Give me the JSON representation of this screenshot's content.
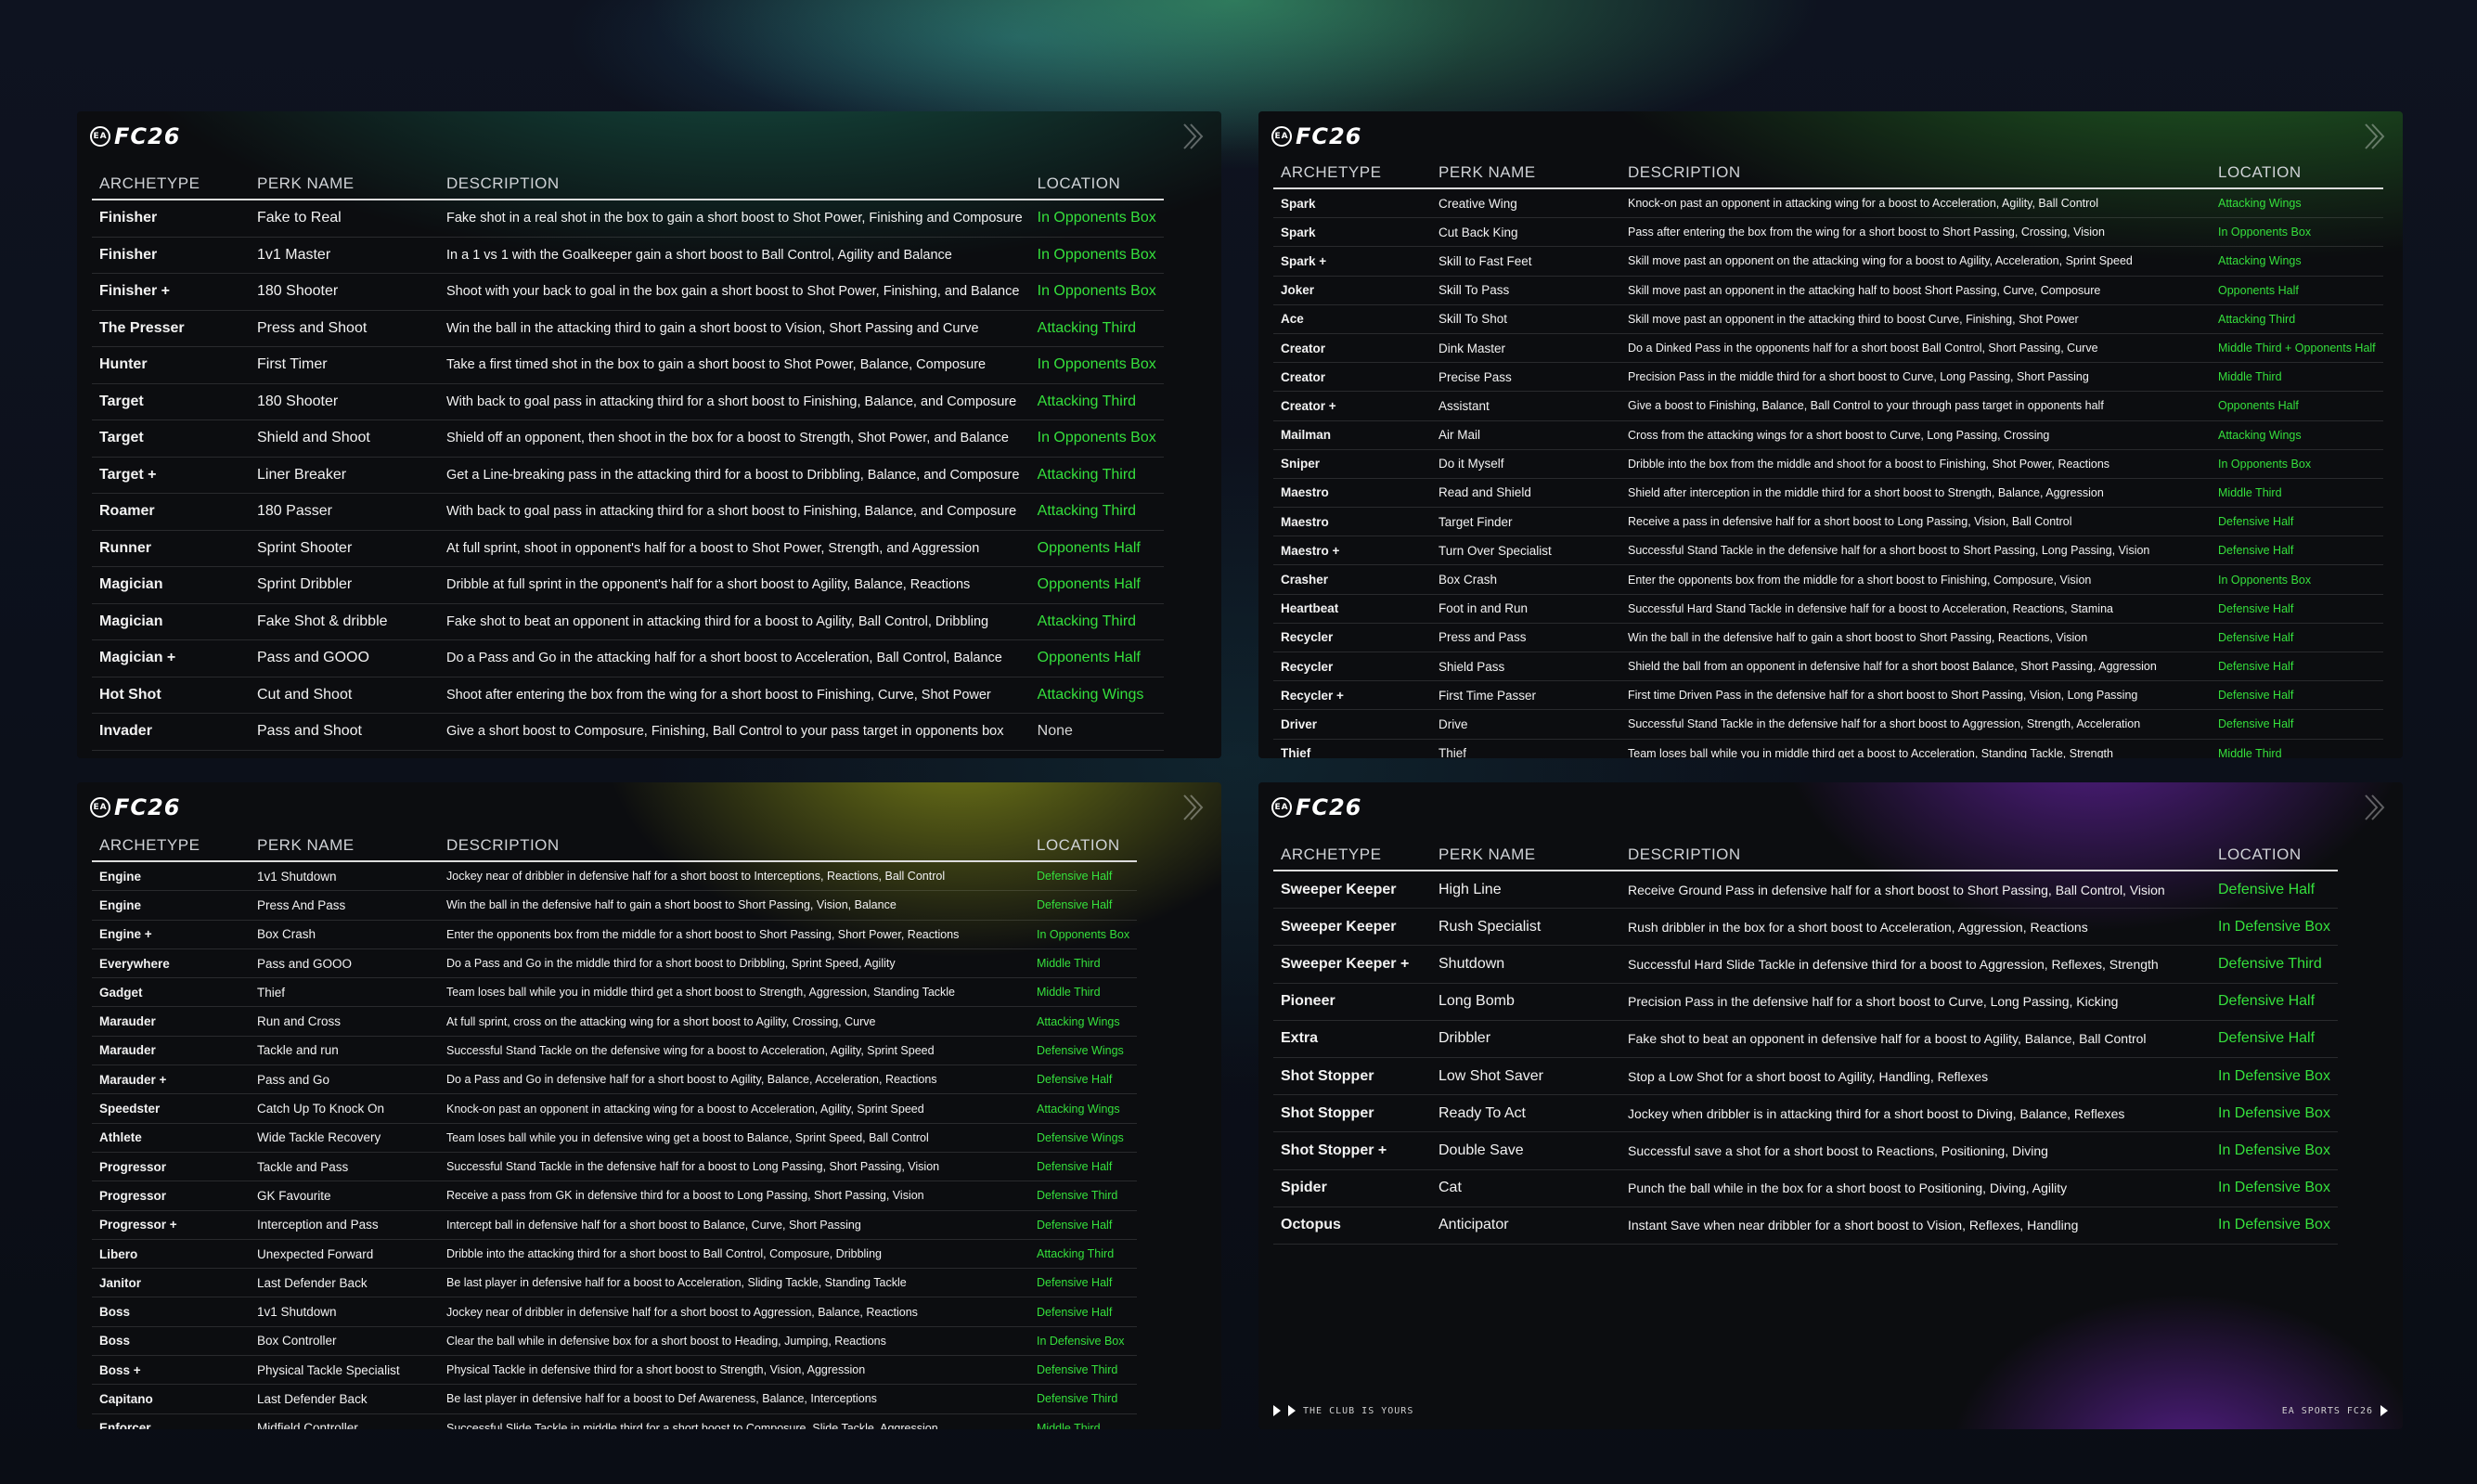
{
  "brand": {
    "logo_text": "FC26",
    "ea_badge": "EA"
  },
  "colors": {
    "location_green": "#35e03c",
    "accent_yellow": "#c8d41e",
    "accent_purple": "#8a2be2"
  },
  "headers": {
    "archetype": "ARCHETYPE",
    "perk_name": "PERK NAME",
    "description": "DESCRIPTION",
    "location": "LOCATION"
  },
  "panel_tl": {
    "rows": [
      {
        "archetype": "Finisher",
        "perk": "Fake to Real",
        "desc": "Fake shot in a real shot in the box to gain a short boost to Shot Power, Finishing and Composure",
        "loc": "In Opponents Box"
      },
      {
        "archetype": "Finisher",
        "perk": "1v1 Master",
        "desc": "In a 1 vs 1 with the Goalkeeper gain a short boost to Ball Control, Agility and Balance",
        "loc": "In Opponents Box"
      },
      {
        "archetype": "Finisher +",
        "perk": "180 Shooter",
        "desc": "Shoot with your back to goal in the box gain a short boost to Shot Power, Finishing, and Balance",
        "loc": "In Opponents Box"
      },
      {
        "archetype": "The Presser",
        "perk": "Press and Shoot",
        "desc": "Win the ball in the attacking third to gain a short boost to Vision, Short Passing and Curve",
        "loc": "Attacking Third"
      },
      {
        "archetype": "Hunter",
        "perk": "First Timer",
        "desc": "Take a first timed shot in the box to gain a short boost to Shot Power, Balance, Composure",
        "loc": "In Opponents Box"
      },
      {
        "archetype": "Target",
        "perk": "180 Shooter",
        "desc": "With back to goal pass in attacking third for a short boost to Finishing, Balance, and Composure",
        "loc": "Attacking Third"
      },
      {
        "archetype": "Target",
        "perk": "Shield and Shoot",
        "desc": "Shield off an opponent, then shoot in the box for a boost to Strength, Shot Power, and Balance",
        "loc": "In Opponents Box"
      },
      {
        "archetype": "Target +",
        "perk": "Liner Breaker",
        "desc": "Get a Line-breaking pass in the attacking third for a boost to Dribbling, Balance, and Composure",
        "loc": "Attacking Third"
      },
      {
        "archetype": "Roamer",
        "perk": "180 Passer",
        "desc": "With back to goal pass in attacking third for a short boost to Finishing, Balance, and Composure",
        "loc": "Attacking Third"
      },
      {
        "archetype": "Runner",
        "perk": "Sprint Shooter",
        "desc": "At full sprint, shoot in opponent's half for a boost to Shot Power, Strength, and Aggression",
        "loc": "Opponents Half"
      },
      {
        "archetype": "Magician",
        "perk": "Sprint Dribbler",
        "desc": "Dribble at full sprint in the opponent's half for a short boost to Agility, Balance, Reactions",
        "loc": "Opponents Half"
      },
      {
        "archetype": "Magician",
        "perk": "Fake Shot & dribble",
        "desc": "Fake shot to beat an opponent in attacking third for a boost to Agility, Ball Control, Dribbling",
        "loc": "Attacking Third"
      },
      {
        "archetype": "Magician +",
        "perk": "Pass and GOOO",
        "desc": "Do a Pass and Go in the attacking half for a short boost to Acceleration, Ball Control, Balance",
        "loc": "Opponents Half"
      },
      {
        "archetype": "Hot Shot",
        "perk": "Cut and Shoot",
        "desc": "Shoot after entering the box from the wing for a short boost to Finishing, Curve, Shot Power",
        "loc": "Attacking Wings"
      },
      {
        "archetype": "Invader",
        "perk": "Pass and Shoot",
        "desc": "Give a short boost to Composure, Finishing, Ball Control to your pass target in opponents box",
        "loc": "None"
      }
    ]
  },
  "panel_tr": {
    "rows": [
      {
        "archetype": "Spark",
        "perk": "Creative Wing",
        "desc": "Knock-on past an opponent in attacking wing for a boost to Acceleration, Agility, Ball Control",
        "loc": "Attacking Wings"
      },
      {
        "archetype": "Spark",
        "perk": "Cut Back King",
        "desc": "Pass after entering the box from the wing for a short boost to Short Passing, Crossing, Vision",
        "loc": "In Opponents Box"
      },
      {
        "archetype": "Spark +",
        "perk": "Skill to Fast Feet",
        "desc": "Skill move past an opponent on the attacking wing for a boost to Agility, Acceleration, Sprint Speed",
        "loc": "Attacking Wings"
      },
      {
        "archetype": "Joker",
        "perk": "Skill To Pass",
        "desc": "Skill move past an opponent in the attacking half to boost Short Passing, Curve, Composure",
        "loc": "Opponents Half"
      },
      {
        "archetype": "Ace",
        "perk": "Skill To Shot",
        "desc": "Skill move past an opponent in the attacking third to boost Curve, Finishing, Shot Power",
        "loc": "Attacking Third"
      },
      {
        "archetype": "Creator",
        "perk": "Dink Master",
        "desc": "Do a Dinked Pass in the opponents half for a short boost Ball Control, Short Passing, Curve",
        "loc": "Middle Third + Opponents Half"
      },
      {
        "archetype": "Creator",
        "perk": "Precise Pass",
        "desc": "Precision Pass in the middle third for a short boost to Curve, Long Passing, Short Passing",
        "loc": "Middle Third"
      },
      {
        "archetype": "Creator +",
        "perk": "Assistant",
        "desc": "Give a boost to Finishing, Balance, Ball Control to your through pass target in opponents half",
        "loc": "Opponents Half"
      },
      {
        "archetype": "Mailman",
        "perk": "Air Mail",
        "desc": "Cross from the attacking wings for a short boost to Curve, Long Passing, Crossing",
        "loc": "Attacking Wings"
      },
      {
        "archetype": "Sniper",
        "perk": "Do it Myself",
        "desc": "Dribble into the box from the middle and shoot for a boost to Finishing, Shot Power, Reactions",
        "loc": "In Opponents Box"
      },
      {
        "archetype": "Maestro",
        "perk": "Read and Shield",
        "desc": "Shield after interception in the middle third for a short boost to Strength, Balance, Aggression",
        "loc": "Middle Third"
      },
      {
        "archetype": "Maestro",
        "perk": "Target Finder",
        "desc": "Receive a pass in defensive half for a short boost to Long Passing, Vision, Ball Control",
        "loc": "Defensive Half"
      },
      {
        "archetype": "Maestro +",
        "perk": "Turn Over Specialist",
        "desc": "Successful Stand Tackle in the defensive half for a short boost to Short Passing, Long Passing, Vision",
        "loc": "Defensive Half"
      },
      {
        "archetype": "Crasher",
        "perk": "Box Crash",
        "desc": "Enter the opponents box from the middle for a short boost to Finishing, Composure, Vision",
        "loc": "In Opponents Box"
      },
      {
        "archetype": "Heartbeat",
        "perk": "Foot in and Run",
        "desc": "Successful Hard Stand Tackle in defensive half for a boost to Acceleration, Reactions, Stamina",
        "loc": "Defensive Half"
      },
      {
        "archetype": "Recycler",
        "perk": "Press and Pass",
        "desc": "Win the ball in the defensive half to gain a short boost to Short Passing, Reactions, Vision",
        "loc": "Defensive Half"
      },
      {
        "archetype": "Recycler",
        "perk": "Shield Pass",
        "desc": "Shield the ball from an opponent in defensive half for a short boost Balance, Short Passing, Aggression",
        "loc": "Defensive Half"
      },
      {
        "archetype": "Recycler +",
        "perk": "First Time Passer",
        "desc": "First time Driven Pass in the defensive half for a short boost to Short Passing, Vision, Long Passing",
        "loc": "Defensive Half"
      },
      {
        "archetype": "Driver",
        "perk": "Drive",
        "desc": "Successful Stand Tackle in the defensive half for a short boost to Aggression, Strength, Acceleration",
        "loc": "Defensive Half"
      },
      {
        "archetype": "Thief",
        "perk": "Thief",
        "desc": "Team loses ball while you in middle third get a boost to Acceleration, Standing Tackle, Strength",
        "loc": "Middle Third"
      }
    ]
  },
  "panel_bl": {
    "rows": [
      {
        "archetype": "Engine",
        "perk": "1v1 Shutdown",
        "desc": "Jockey near of dribbler in defensive half for a short boost to Interceptions, Reactions, Ball Control",
        "loc": "Defensive Half"
      },
      {
        "archetype": "Engine",
        "perk": "Press And Pass",
        "desc": "Win the ball in the defensive half to gain a short boost to Short Passing, Vision, Balance",
        "loc": "Defensive Half"
      },
      {
        "archetype": "Engine +",
        "perk": "Box Crash",
        "desc": "Enter the opponents box from the middle for a short boost to Short Passing, Short Power, Reactions",
        "loc": "In Opponents Box"
      },
      {
        "archetype": "Everywhere",
        "perk": "Pass and GOOO",
        "desc": "Do a Pass and Go in the middle third for a short boost to Dribbling, Sprint Speed, Agility",
        "loc": "Middle Third"
      },
      {
        "archetype": "Gadget",
        "perk": "Thief",
        "desc": "Team loses ball while you in middle third get a short boost to Strength, Aggression, Standing Tackle",
        "loc": "Middle Third"
      },
      {
        "archetype": "Marauder",
        "perk": "Run and Cross",
        "desc": "At full sprint, cross on the attacking wing for a short boost to Agility, Crossing, Curve",
        "loc": "Attacking Wings"
      },
      {
        "archetype": "Marauder",
        "perk": "Tackle and run",
        "desc": "Successful Stand Tackle on the defensive wing for a boost to Acceleration, Agility, Sprint Speed",
        "loc": "Defensive Wings"
      },
      {
        "archetype": "Marauder +",
        "perk": "Pass and Go",
        "desc": "Do a Pass and Go in defensive half for a short boost to Agility, Balance, Acceleration, Reactions",
        "loc": "Defensive Half"
      },
      {
        "archetype": "Speedster",
        "perk": "Catch Up To Knock On",
        "desc": "Knock-on past an opponent in attacking wing for a boost to Acceleration, Agility, Sprint Speed",
        "loc": "Attacking Wings"
      },
      {
        "archetype": "Athlete",
        "perk": "Wide Tackle Recovery",
        "desc": "Team loses ball while you in defensive wing get a boost to Balance, Sprint Speed, Ball Control",
        "loc": "Defensive Wings"
      },
      {
        "archetype": "Progressor",
        "perk": "Tackle and Pass",
        "desc": "Successful Stand Tackle in the defensive half for a boost to Long Passing, Short Passing, Vision",
        "loc": "Defensive Half"
      },
      {
        "archetype": "Progressor",
        "perk": "GK Favourite",
        "desc": "Receive a pass from GK in defensive third for a boost to Long Passing, Short Passing, Vision",
        "loc": "Defensive Third"
      },
      {
        "archetype": "Progressor +",
        "perk": "Interception and Pass",
        "desc": "Intercept ball in defensive half for a short boost to Balance, Curve, Short Passing",
        "loc": "Defensive Half"
      },
      {
        "archetype": "Libero",
        "perk": "Unexpected Forward",
        "desc": "Dribble into the attacking third for a short boost to Ball Control, Composure, Dribbling",
        "loc": "Attacking Third"
      },
      {
        "archetype": "Janitor",
        "perk": "Last Defender Back",
        "desc": "Be last player in defensive half for a boost to Acceleration, Sliding Tackle, Standing Tackle",
        "loc": "Defensive Half"
      },
      {
        "archetype": "Boss",
        "perk": "1v1 Shutdown",
        "desc": "Jockey near of dribbler in defensive half for a short boost to Aggression, Balance, Reactions",
        "loc": "Defensive Half"
      },
      {
        "archetype": "Boss",
        "perk": "Box Controller",
        "desc": "Clear the ball while in defensive box for a short boost to Heading, Jumping, Reactions",
        "loc": "In Defensive Box"
      },
      {
        "archetype": "Boss +",
        "perk": "Physical Tackle Specialist",
        "desc": "Physical Tackle in defensive third for a short boost to Strength, Vision, Aggression",
        "loc": "Defensive Third"
      },
      {
        "archetype": "Capitano",
        "perk": "Last Defender Back",
        "desc": "Be last player in defensive half for a boost to Def Awareness, Balance, Interceptions",
        "loc": "Defensive Third"
      },
      {
        "archetype": "Enforcer",
        "perk": "Midfield Controller",
        "desc": "Successful Slide Tackle in middle third for a short boost to Composure, Slide Tackle, Aggression",
        "loc": "Middle Third"
      }
    ]
  },
  "panel_br": {
    "rows": [
      {
        "archetype": "Sweeper Keeper",
        "perk": "High Line",
        "desc": "Receive Ground Pass in defensive half for a short boost to Short Passing, Ball Control, Vision",
        "loc": "Defensive Half"
      },
      {
        "archetype": "Sweeper Keeper",
        "perk": "Rush Specialist",
        "desc": "Rush dribbler in the box for a short boost to Acceleration, Aggression, Reactions",
        "loc": "In Defensive Box"
      },
      {
        "archetype": "Sweeper Keeper +",
        "perk": "Shutdown",
        "desc": "Successful Hard Slide Tackle in defensive third for a boost to Aggression, Reflexes, Strength",
        "loc": "Defensive Third"
      },
      {
        "archetype": "Pioneer",
        "perk": "Long Bomb",
        "desc": "Precision Pass in the defensive half for a short boost to Curve, Long Passing, Kicking",
        "loc": "Defensive Half"
      },
      {
        "archetype": "Extra",
        "perk": "Dribbler",
        "desc": "Fake shot to beat an opponent in defensive half for a boost to Agility, Balance, Ball Control",
        "loc": "Defensive Half"
      },
      {
        "archetype": "Shot Stopper",
        "perk": "Low Shot Saver",
        "desc": "Stop a Low Shot for a short boost to Agility, Handling, Reflexes",
        "loc": "In Defensive Box"
      },
      {
        "archetype": "Shot Stopper",
        "perk": "Ready To Act",
        "desc": "Jockey when dribbler is in attacking third for a short boost to Diving, Balance, Reflexes",
        "loc": "In Defensive Box"
      },
      {
        "archetype": "Shot Stopper +",
        "perk": "Double Save",
        "desc": "Successful save a shot for a short boost to Reactions, Positioning, Diving",
        "loc": "In Defensive Box"
      },
      {
        "archetype": "Spider",
        "perk": "Cat",
        "desc": "Punch the ball while in the box for a short boost to Positioning, Diving, Agility",
        "loc": "In Defensive Box"
      },
      {
        "archetype": "Octopus",
        "perk": "Anticipator",
        "desc": "Instant Save when near dribbler for a short boost to Vision, Reflexes, Handling",
        "loc": "In Defensive Box"
      }
    ],
    "footer_left": "THE CLUB IS YOURS",
    "footer_right": "EA SPORTS FC26"
  }
}
